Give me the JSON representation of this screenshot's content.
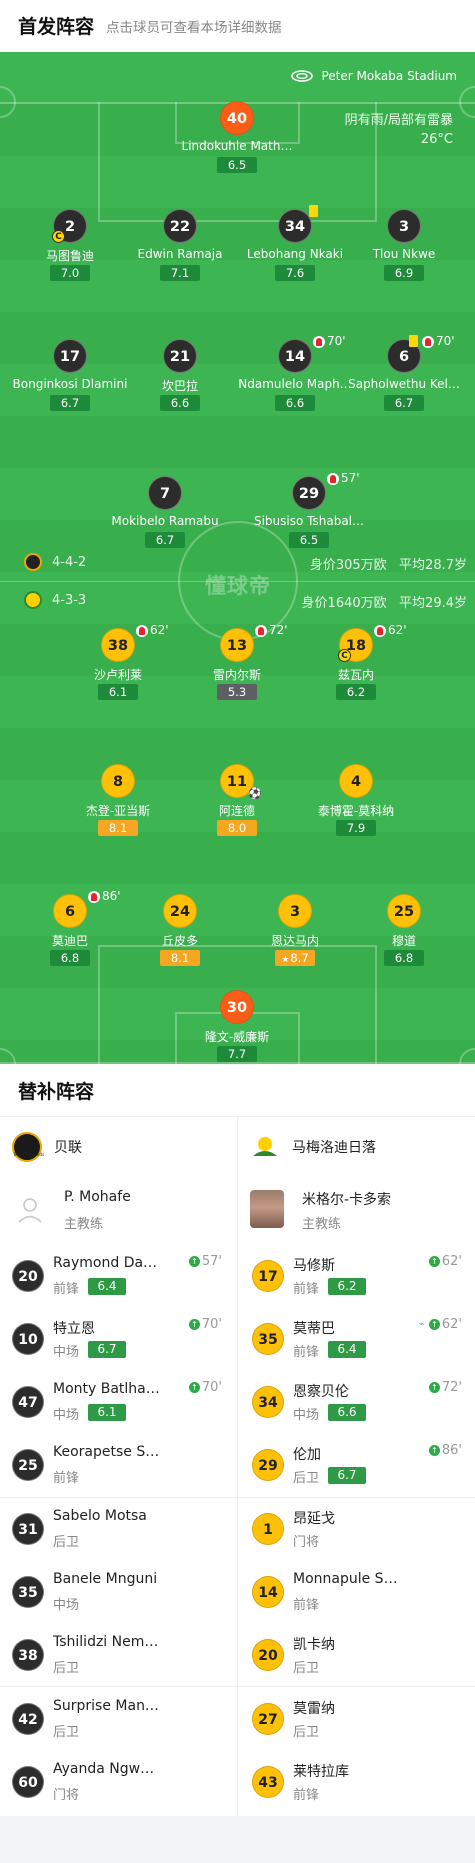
{
  "lineup_header": {
    "title": "首发阵容",
    "subtitle": "点击球员可查看本场详细数据"
  },
  "stadium": "Peter Mokaba Stadium",
  "weather": {
    "condition": "阴有雨/局部有雷暴",
    "temp": "26°C"
  },
  "watermark": "懂球帝",
  "home_team": {
    "formation": "4-4-2",
    "value": "身价305万欧",
    "avg_age": "平均28.7岁",
    "color": "#2c2c2c"
  },
  "away_team": {
    "formation": "4-3-3",
    "value": "身价1640万欧",
    "avg_age": "平均29.4岁",
    "color": "#ffc107"
  },
  "home_players": [
    {
      "num": "40",
      "name": "Lindokuhle Math…",
      "rating": "6.5"
    },
    {
      "num": "2",
      "name": "马图鲁迪",
      "rating": "7.0",
      "captain": "C"
    },
    {
      "num": "22",
      "name": "Edwin Ramaja",
      "rating": "7.1"
    },
    {
      "num": "34",
      "name": "Lebohang Nkaki",
      "rating": "7.6",
      "yellow_card": true
    },
    {
      "num": "3",
      "name": "Tlou Nkwe",
      "rating": "6.9"
    },
    {
      "num": "17",
      "name": "Bonginkosi Dlamini",
      "rating": "6.7"
    },
    {
      "num": "21",
      "name": "坎巴拉",
      "rating": "6.6"
    },
    {
      "num": "14",
      "name": "Ndamulelo Maph…",
      "rating": "6.6",
      "sub_time": "70'"
    },
    {
      "num": "6",
      "name": "Sapholwethu Kel…",
      "rating": "6.7",
      "sub_time": "70'",
      "yellow_card": true
    },
    {
      "num": "7",
      "name": "Mokibelo Ramabu",
      "rating": "6.7"
    },
    {
      "num": "29",
      "name": "Sibusiso Tshabal…",
      "rating": "6.5",
      "sub_time": "57'"
    }
  ],
  "away_players": [
    {
      "num": "38",
      "name": "沙卢利莱",
      "rating": "6.1",
      "sub_time": "62'"
    },
    {
      "num": "13",
      "name": "雷内尔斯",
      "rating": "5.3",
      "sub_time": "72'"
    },
    {
      "num": "18",
      "name": "兹瓦内",
      "rating": "6.2",
      "sub_time": "62'",
      "captain": "C"
    },
    {
      "num": "8",
      "name": "杰登-亚当斯",
      "rating": "8.1"
    },
    {
      "num": "11",
      "name": "阿连德",
      "rating": "8.0",
      "goal": "⚽"
    },
    {
      "num": "4",
      "name": "泰博霍-莫科纳",
      "rating": "7.9"
    },
    {
      "num": "6",
      "name": "莫迪巴",
      "rating": "6.8",
      "sub_time": "86'"
    },
    {
      "num": "24",
      "name": "丘皮多",
      "rating": "8.1"
    },
    {
      "num": "3",
      "name": "恩达马内",
      "rating": "8.7",
      "mvp": "★"
    },
    {
      "num": "25",
      "name": "穆道",
      "rating": "6.8"
    },
    {
      "num": "30",
      "name": "隆文-威廉斯",
      "rating": "7.7"
    }
  ],
  "subs_header": "替补阵容",
  "home_subs": {
    "team_name": "贝联",
    "logo_text": "Black Leopards",
    "coach": {
      "name": "P. Mohafe",
      "role": "主教练"
    },
    "players": [
      {
        "num": "20",
        "name": "Raymond Da…",
        "pos": "前锋",
        "rating": "6.4",
        "time": "57'"
      },
      {
        "num": "10",
        "name": "特立恩",
        "pos": "中场",
        "rating": "6.7",
        "time": "70'"
      },
      {
        "num": "47",
        "name": "Monty Batlha…",
        "pos": "中场",
        "rating": "6.1",
        "time": "70'"
      },
      {
        "num": "25",
        "name": "Keorapetse S…",
        "pos": "前锋"
      },
      {
        "num": "31",
        "name": "Sabelo Motsa",
        "pos": "后卫"
      },
      {
        "num": "35",
        "name": "Banele Mnguni",
        "pos": "中场"
      },
      {
        "num": "38",
        "name": "Tshilidzi Nem…",
        "pos": "后卫"
      },
      {
        "num": "42",
        "name": "Surprise Man…",
        "pos": "后卫"
      },
      {
        "num": "60",
        "name": "Ayanda Ngw…",
        "pos": "门将"
      }
    ]
  },
  "away_subs": {
    "team_name": "马梅洛迪日落",
    "coach": {
      "name": "米格尔-卡多索",
      "role": "主教练"
    },
    "players": [
      {
        "num": "17",
        "name": "马修斯",
        "pos": "前锋",
        "rating": "6.2",
        "time": "62'"
      },
      {
        "num": "35",
        "name": "莫蒂巴",
        "pos": "前锋",
        "rating": "6.4",
        "time": "62'"
      },
      {
        "num": "34",
        "name": "恩察贝伦",
        "pos": "中场",
        "rating": "6.6",
        "time": "72'"
      },
      {
        "num": "29",
        "name": "伦加",
        "pos": "后卫",
        "rating": "6.7",
        "time": "86'"
      },
      {
        "num": "1",
        "name": "昂延戈",
        "pos": "门将"
      },
      {
        "num": "14",
        "name": "Monnapule S…",
        "pos": "前锋"
      },
      {
        "num": "20",
        "name": "凯卡纳",
        "pos": "后卫"
      },
      {
        "num": "27",
        "name": "莫雷纳",
        "pos": "后卫"
      },
      {
        "num": "43",
        "name": "莱特拉库",
        "pos": "前锋"
      }
    ]
  }
}
